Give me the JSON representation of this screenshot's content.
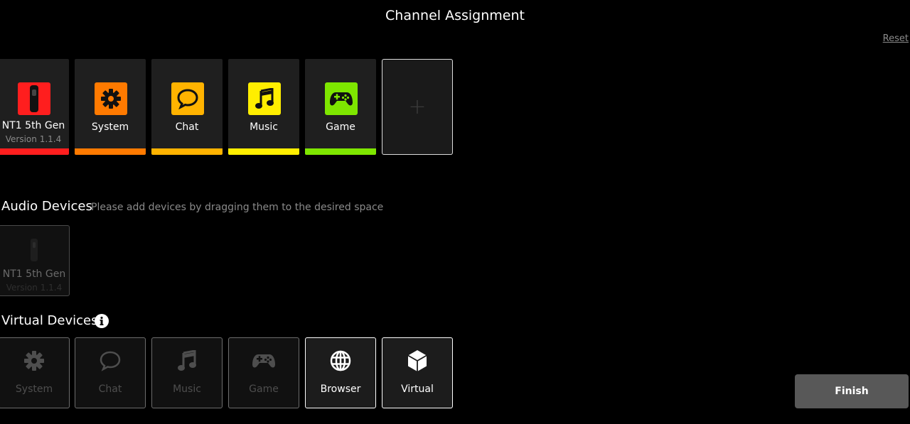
{
  "header": {
    "title": "Channel Assignment",
    "reset_label": "Reset"
  },
  "channels": [
    {
      "label": "NT1 5th Gen",
      "sub": "Version 1.1.4",
      "color": "#ff1e1e",
      "icon": "microphone-icon"
    },
    {
      "label": "System",
      "color": "#ff7a00",
      "icon": "gear-icon"
    },
    {
      "label": "Chat",
      "color": "#ffb300",
      "icon": "chat-bubble-icon"
    },
    {
      "label": "Music",
      "color": "#ffee00",
      "icon": "music-note-icon"
    },
    {
      "label": "Game",
      "color": "#7ee600",
      "icon": "gamepad-icon"
    }
  ],
  "add_channel": {
    "icon": "plus-icon",
    "label": "+"
  },
  "audio_devices": {
    "title": "Audio Devices",
    "hint": "Please add devices by dragging them to the desired space",
    "items": [
      {
        "label": "NT1 5th Gen",
        "sub": "Version 1.1.4",
        "icon": "microphone-icon"
      }
    ]
  },
  "virtual_devices": {
    "title": "Virtual Devices",
    "info_icon": "info-icon",
    "items": [
      {
        "label": "System",
        "icon": "gear-icon",
        "active": false
      },
      {
        "label": "Chat",
        "icon": "chat-bubble-icon",
        "active": false
      },
      {
        "label": "Music",
        "icon": "music-note-icon",
        "active": false
      },
      {
        "label": "Game",
        "icon": "gamepad-icon",
        "active": false
      },
      {
        "label": "Browser",
        "icon": "globe-icon",
        "active": true
      },
      {
        "label": "Virtual",
        "icon": "cube-icon",
        "active": true
      }
    ]
  },
  "footer": {
    "finish_label": "Finish"
  },
  "colors": {
    "background": "#000000",
    "tile": "#1f1f1f",
    "finish_button": "#585858"
  }
}
